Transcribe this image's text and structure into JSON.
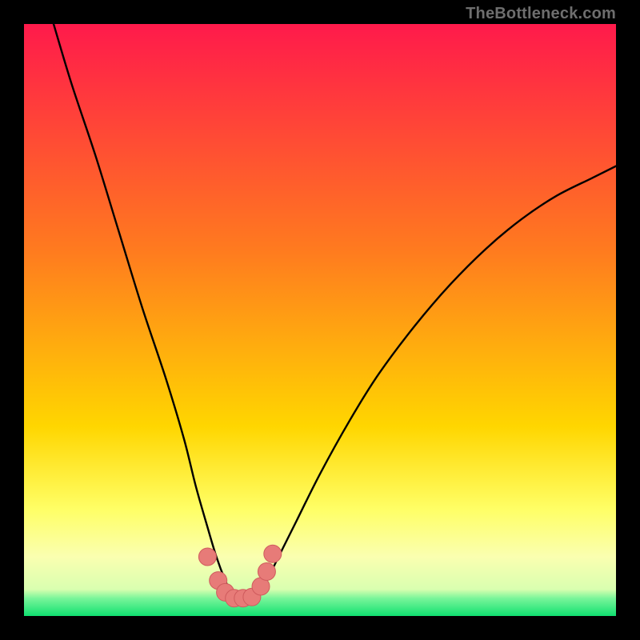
{
  "watermark": "TheBottleneck.com",
  "colors": {
    "frame": "#000000",
    "grad_top": "#ff1a4b",
    "grad_mid1": "#ff7a1f",
    "grad_mid2": "#ffd600",
    "grad_band": "#faffb0",
    "grad_bottom": "#10e070",
    "curve": "#000000",
    "marker_fill": "#e77b78",
    "marker_stroke": "#cf5b5d"
  },
  "chart_data": {
    "type": "line",
    "title": "",
    "xlabel": "",
    "ylabel": "",
    "xlim": [
      0,
      100
    ],
    "ylim": [
      0,
      100
    ],
    "series": [
      {
        "name": "bottleneck-curve",
        "x": [
          5,
          8,
          12,
          16,
          20,
          24,
          27,
          29,
          31,
          32.5,
          34,
          35,
          36,
          37,
          38,
          39.5,
          41,
          43,
          46,
          50,
          55,
          60,
          66,
          72,
          78,
          84,
          90,
          96,
          100
        ],
        "y": [
          100,
          90,
          78,
          65,
          52,
          40,
          30,
          22,
          15,
          10,
          6,
          4,
          3,
          2.5,
          3,
          4,
          6,
          10,
          16,
          24,
          33,
          41,
          49,
          56,
          62,
          67,
          71,
          74,
          76
        ]
      }
    ],
    "markers": [
      {
        "x": 31.0,
        "y": 10.0
      },
      {
        "x": 32.8,
        "y": 6.0
      },
      {
        "x": 34.0,
        "y": 4.0
      },
      {
        "x": 35.5,
        "y": 3.0
      },
      {
        "x": 37.0,
        "y": 3.0
      },
      {
        "x": 38.5,
        "y": 3.2
      },
      {
        "x": 40.0,
        "y": 5.0
      },
      {
        "x": 41.0,
        "y": 7.5
      },
      {
        "x": 42.0,
        "y": 10.5
      }
    ],
    "annotations": []
  }
}
